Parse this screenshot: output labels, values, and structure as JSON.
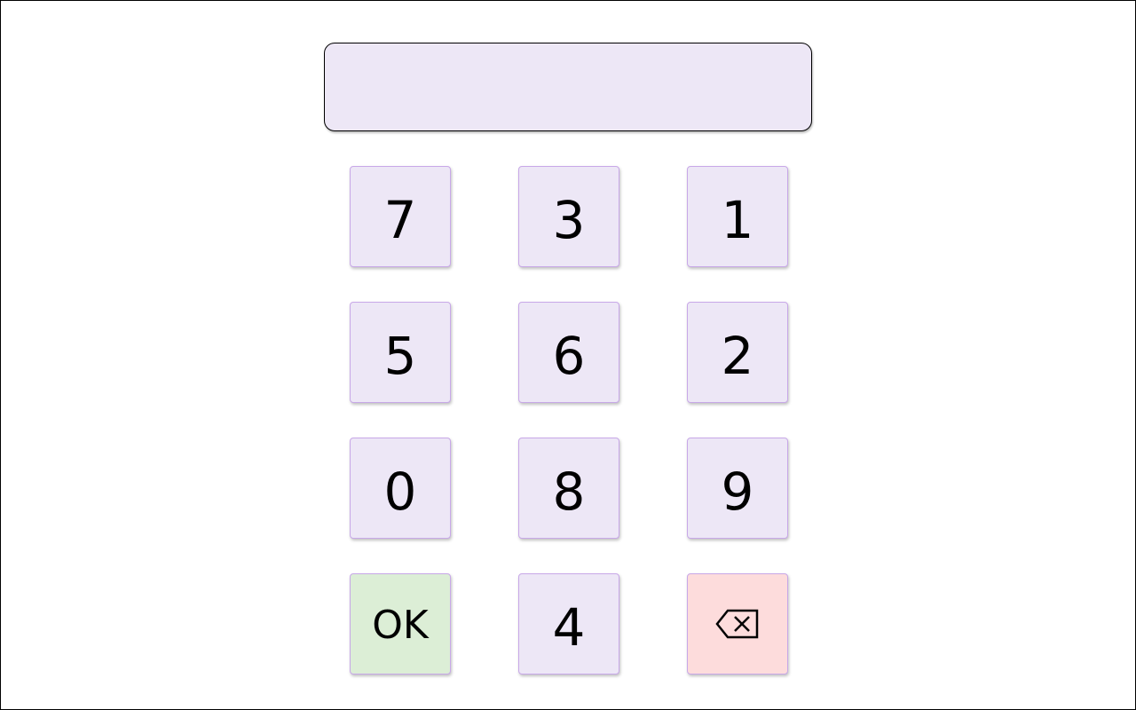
{
  "display": {
    "value": ""
  },
  "keypad": {
    "rows": [
      [
        "7",
        "3",
        "1"
      ],
      [
        "5",
        "6",
        "2"
      ],
      [
        "0",
        "8",
        "9"
      ]
    ],
    "ok_label": "OK",
    "bottom_digit": "4",
    "backspace_icon": "backspace-icon"
  },
  "colors": {
    "key_bg": "#ede7f6",
    "key_border": "#c8a8e8",
    "ok_bg": "#dceed6",
    "backspace_bg": "#fddcdc",
    "display_bg": "#ede7f6"
  }
}
